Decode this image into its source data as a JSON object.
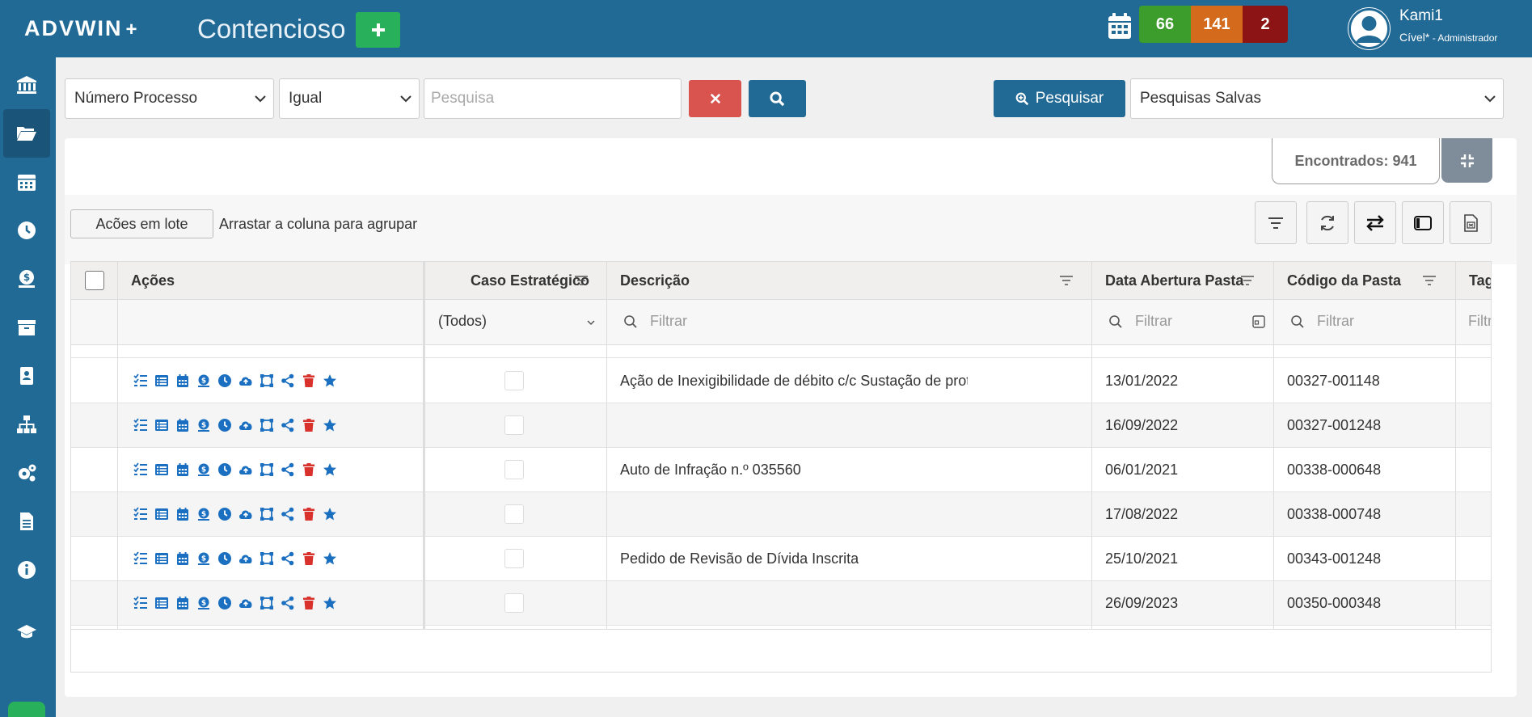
{
  "header": {
    "logo": "ADVWIN",
    "logo_plus": "+",
    "module_title": "Contencioso",
    "badges": [
      "66",
      "141",
      "2"
    ],
    "user_name": "Kami1",
    "user_group": "Cível*",
    "user_role": " - Administrador"
  },
  "sidebar": {
    "items": [
      "bank-icon",
      "folder-open-icon",
      "calendar-icon",
      "clock-icon",
      "money-icon",
      "archive-icon",
      "contact-card-icon",
      "sitemap-icon",
      "cogs-icon",
      "document-icon",
      "info-icon",
      "graduation-cap-icon"
    ]
  },
  "search": {
    "field_select": "Número Processo",
    "operator_select": "Igual",
    "placeholder": "Pesquisa",
    "pesquisar_label": "Pesquisar",
    "saved_select": "Pesquisas Salvas"
  },
  "results": {
    "found_label": "Encontrados: 941"
  },
  "toolbar": {
    "batch_label": "Acões em lote",
    "group_hint": "Arrastar a coluna para agrupar"
  },
  "grid": {
    "columns": [
      "Ações",
      "Caso Estratégico",
      "Descrição",
      "Data Abertura Pasta",
      "Código da Pasta",
      "Tag"
    ],
    "filter_all": "(Todos)",
    "filter_placeholder": "Filtrar",
    "filter_partial": "Filtr",
    "rows": [
      {
        "descricao": "Ação de Inexigibilidade de débito c/c Sustação de protesto c/c pedid...",
        "data": "13/01/2022",
        "codigo": "00327-001148"
      },
      {
        "descricao": "",
        "data": "16/09/2022",
        "codigo": "00327-001248"
      },
      {
        "descricao": "Auto de Infração n.º 035560",
        "data": "06/01/2021",
        "codigo": "00338-000648"
      },
      {
        "descricao": "",
        "data": "17/08/2022",
        "codigo": "00338-000748"
      },
      {
        "descricao": "Pedido de Revisão de Dívida Inscrita",
        "data": "25/10/2021",
        "codigo": "00343-001248"
      },
      {
        "descricao": "",
        "data": "26/09/2023",
        "codigo": "00350-000348"
      }
    ]
  },
  "colors": {
    "primary": "#226a96",
    "success": "#28b05a",
    "danger": "#d9534f",
    "icon_blue": "#1b6fc0",
    "icon_red": "#d9312b"
  }
}
